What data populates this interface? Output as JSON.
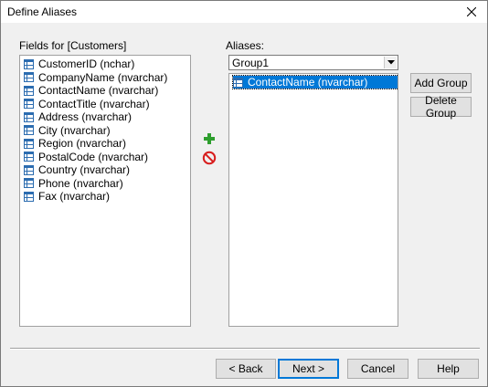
{
  "window": {
    "title": "Define Aliases"
  },
  "fields_panel": {
    "label": "Fields for [Customers]",
    "items": [
      "CustomerID (nchar)",
      "CompanyName (nvarchar)",
      "ContactName (nvarchar)",
      "ContactTitle (nvarchar)",
      "Address (nvarchar)",
      "City (nvarchar)",
      "Region (nvarchar)",
      "PostalCode (nvarchar)",
      "Country (nvarchar)",
      "Phone (nvarchar)",
      "Fax (nvarchar)"
    ]
  },
  "aliases_panel": {
    "label": "Aliases:",
    "group_select": "Group1",
    "items": [
      "ContactName (nvarchar)"
    ]
  },
  "side_buttons": {
    "add_group": "Add Group",
    "delete_group": "Delete Group"
  },
  "footer": {
    "back": "< Back",
    "next": "Next >",
    "cancel": "Cancel",
    "help": "Help"
  },
  "colors": {
    "selection": "#0078d7",
    "add_icon": "#2e9e2e",
    "remove_icon": "#d81e1e",
    "field_icon": "#2b6cb0"
  }
}
